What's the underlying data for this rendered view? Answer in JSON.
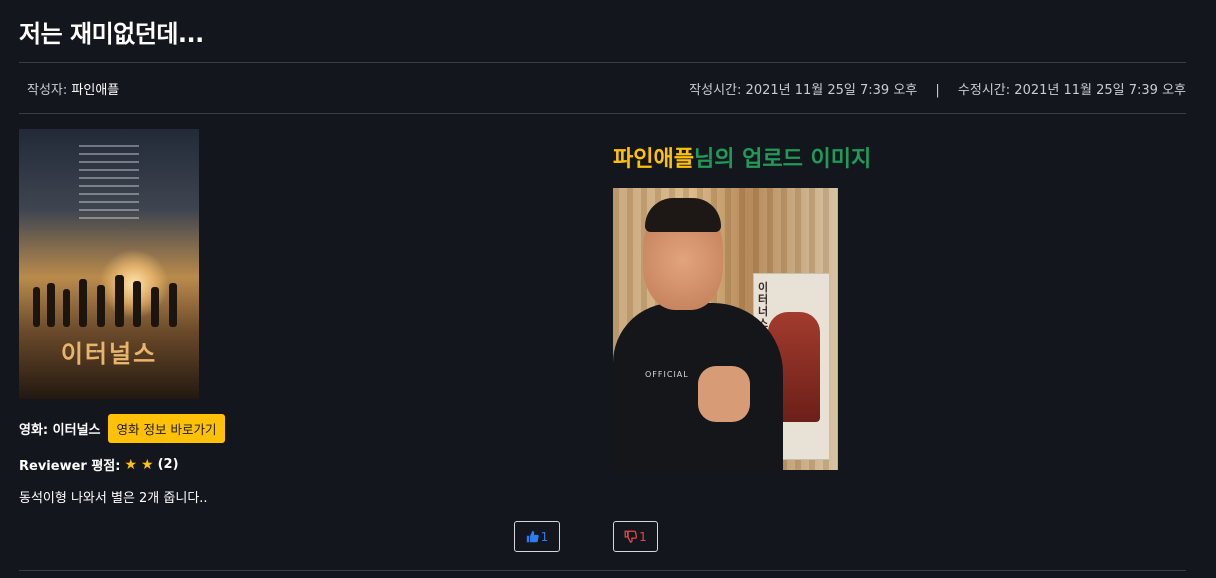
{
  "post": {
    "title": "저는 재미없던데...",
    "author_label": "작성자:",
    "author": "파인애플",
    "created_label": "작성시간:",
    "created": "2021년 11월 25일 7:39 오후",
    "separator": "|",
    "modified_label": "수정시간:",
    "modified": "2021년 11월 25일 7:39 오후"
  },
  "movie": {
    "poster_title": "이터널스",
    "label": "영화: 이터널스",
    "info_button": "영화 정보 바로가기",
    "rating_label": "Reviewer 평점:",
    "stars": [
      "★",
      "★"
    ],
    "rating_value": "(2)",
    "review_text": "동석이형 나와서 별은 2개 줍니다.."
  },
  "upload": {
    "name": "파인애플",
    "suffix": "님의 업로드 이미지",
    "photo_poster_text": "이터너스",
    "photo_shirt_text": "OFFICIAL"
  },
  "votes": {
    "up_count": "1",
    "down_count": "1"
  },
  "colors": {
    "background": "#14161e",
    "accent_yellow": "#ffc107",
    "accent_green": "#1f9a57",
    "like_blue": "#2e7df0",
    "dislike_red": "#e14949"
  },
  "icons": {
    "like": "thumbs-up-icon",
    "dislike": "thumbs-down-icon"
  }
}
